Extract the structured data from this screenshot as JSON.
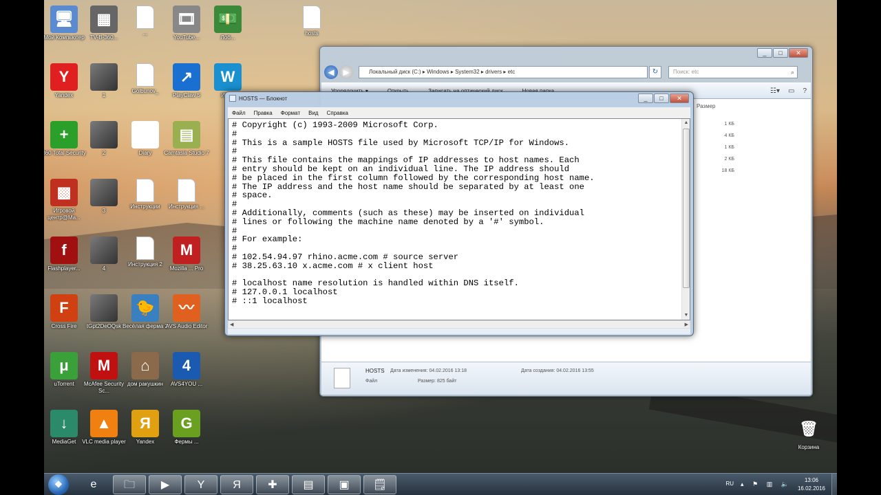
{
  "desktop": {
    "icons": [
      {
        "label": "Мой Компьютер",
        "glyph": "🖥",
        "color": "#5a8ad0"
      },
      {
        "label": "TV-B-360...",
        "glyph": "▦",
        "color": "#666"
      },
      {
        "label": "...",
        "glyph": "",
        "color": "#fff"
      },
      {
        "label": "YouTube...",
        "glyph": "🎞",
        "color": "#888"
      },
      {
        "label": "Лоб...",
        "glyph": "💵",
        "color": "#3a8a3a"
      },
      {
        "label": "Yandex",
        "glyph": "Y",
        "color": "#e02020"
      },
      {
        "label": "1",
        "glyph": "",
        "color": "#555"
      },
      {
        "label": "Golbunov_",
        "glyph": "",
        "color": "#fff"
      },
      {
        "label": "PlayClaw 5",
        "glyph": "↗",
        "color": "#1a70d0"
      },
      {
        "label": "Игр...",
        "glyph": "W",
        "color": "#1a90d0"
      },
      {
        "label": "360 Total Security",
        "glyph": "+",
        "color": "#2aa02a"
      },
      {
        "label": "2",
        "glyph": "",
        "color": "#555"
      },
      {
        "label": "Diary",
        "glyph": "✔",
        "color": "#ffffff"
      },
      {
        "label": "Camtasia Studio 7",
        "glyph": "▤",
        "color": "#9ab050"
      },
      {
        "label": "Игровой центр@Ма...",
        "glyph": "▩",
        "color": "#c03020"
      },
      {
        "label": "3",
        "glyph": "",
        "color": "#555"
      },
      {
        "label": "Инструкции",
        "glyph": "",
        "color": "#fff"
      },
      {
        "label": "Инструкция ...",
        "glyph": "",
        "color": "#fff"
      },
      {
        "label": "Flashplayer...",
        "glyph": "f",
        "color": "#a01010"
      },
      {
        "label": "4",
        "glyph": "",
        "color": "#555"
      },
      {
        "label": "Инструкция 2",
        "glyph": "",
        "color": "#fff"
      },
      {
        "label": "Mozilla ... Pro",
        "glyph": "M",
        "color": "#c02020"
      },
      {
        "label": "Cross Fire",
        "glyph": "F",
        "color": "#d04010"
      },
      {
        "label": "tGpt2DeOQsk",
        "glyph": "",
        "color": "#333"
      },
      {
        "label": "Весёлая ферма 2",
        "glyph": "🐤",
        "color": "#3a80c0"
      },
      {
        "label": "AVS Audio Editor",
        "glyph": "〰",
        "color": "#e06020"
      },
      {
        "label": "uTorrent",
        "glyph": "μ",
        "color": "#3aa03a"
      },
      {
        "label": "McAfee Security Sc...",
        "glyph": "M",
        "color": "#c01010"
      },
      {
        "label": "дом ракушкин",
        "glyph": "⌂",
        "color": "#8a6a4a"
      },
      {
        "label": "AVS4YOU ...",
        "glyph": "4",
        "color": "#1a5ab0"
      },
      {
        "label": "MediaGet",
        "glyph": "↓",
        "color": "#2a8a6a"
      },
      {
        "label": "VLC media player",
        "glyph": "▲",
        "color": "#f08010"
      },
      {
        "label": "Yandex",
        "glyph": "Я",
        "color": "#e0a010"
      },
      {
        "label": "Фермы ...",
        "glyph": "G",
        "color": "#6aa020"
      },
      {
        "label": "Корзина",
        "glyph": "🗑",
        "color": "#8ab0d0"
      }
    ],
    "top_file_label": "hosts"
  },
  "explorer": {
    "address": "Локальный диск (C:) ▸ Windows ▸ System32 ▸ drivers ▸ etc",
    "search_placeholder": "Поиск: etc",
    "commands": [
      "Упорядочить ▾",
      "Открыть",
      "Записать на оптический диск",
      "Новая папка"
    ],
    "size_header": "Размер",
    "sizes": [
      "1 КБ",
      "4 КБ",
      "1 КБ",
      "2 КБ",
      "18 КБ"
    ],
    "details": {
      "name": "HOSTS",
      "modified": "Дата изменения: 04.02.2016 13:18",
      "type": "Файл",
      "size": "Размер: 825 байт",
      "created": "Дата создания: 04.02.2016 13:55"
    }
  },
  "notepad": {
    "title": "HOSTS — Блокнот",
    "menu": [
      "Файл",
      "Правка",
      "Формат",
      "Вид",
      "Справка"
    ],
    "lines": [
      "# Copyright (c) 1993-2009 Microsoft Corp.",
      "#",
      "# This is a sample HOSTS file used by Microsoft TCP/IP for Windows.",
      "#",
      "# This file contains the mappings of IP addresses to host names. Each",
      "# entry should be kept on an individual line. The IP address should",
      "# be placed in the first column followed by the corresponding host name.",
      "# The IP address and the host name should be separated by at least one",
      "# space.",
      "#",
      "# Additionally, comments (such as these) may be inserted on individual",
      "# lines or following the machine name denoted by a '#' symbol.",
      "#",
      "# For example:",
      "#",
      "# 102.54.94.97 rhino.acme.com # source server",
      "# 38.25.63.10 x.acme.com # x client host",
      "",
      "# localhost name resolution is handled within DNS itself.",
      "# 127.0.0.1 localhost",
      "# ::1 localhost"
    ]
  },
  "taskbar": {
    "start_glyph": "❖",
    "items": [
      {
        "name": "ie",
        "glyph": "e"
      },
      {
        "name": "explorer",
        "glyph": "🗀"
      },
      {
        "name": "media",
        "glyph": "▶"
      },
      {
        "name": "yandex-browser",
        "glyph": "Y"
      },
      {
        "name": "yandex",
        "glyph": "Я"
      },
      {
        "name": "app1",
        "glyph": "✚"
      },
      {
        "name": "camtasia",
        "glyph": "▤"
      },
      {
        "name": "app2",
        "glyph": "▣"
      },
      {
        "name": "notepad",
        "glyph": "🗒"
      }
    ],
    "language": "RU",
    "time": "13:06",
    "date": "16.02.2016"
  }
}
